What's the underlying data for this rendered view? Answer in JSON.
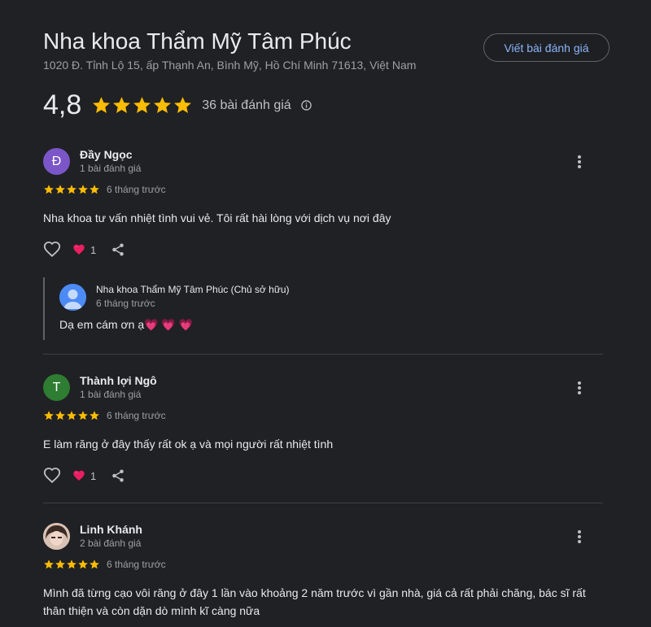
{
  "place": {
    "title": "Nha khoa Thẩm Mỹ Tâm Phúc",
    "address": "1020 Đ. Tỉnh Lộ 15, ấp Thạnh An, Bình Mỹ, Hồ Chí Minh 71613, Việt Nam",
    "rating": "4,8",
    "review_count": "36 bài đánh giá",
    "write_review_label": "Viết bài đánh giá"
  },
  "colors": {
    "star": "#fbbc04",
    "link": "#8ab4f8",
    "heart": "#e91e63"
  },
  "reviews": [
    {
      "avatar_letter": "Đ",
      "avatar_color": "#7b56c8",
      "name": "Đầy Ngọc",
      "meta": "1 bài đánh giá",
      "stars": 5,
      "time": "6 tháng trước",
      "text": "Nha khoa tư vấn nhiệt tình vui vẻ. Tôi rất hài lòng với dịch vụ nơi đây",
      "reactions": "1",
      "reply": {
        "name": "Nha khoa Thẩm Mỹ Tâm Phúc (Chủ sở hữu)",
        "time": "6 tháng trước",
        "text": "Dạ em cám ơn ạ💗 💗 💗"
      }
    },
    {
      "avatar_letter": "T",
      "avatar_color": "#2e7d32",
      "name": "Thành lợi Ngô",
      "meta": "1 bài đánh giá",
      "stars": 5,
      "time": "6 tháng trước",
      "text": "E làm răng ở đây thấy rất ok ạ và mọi người rất nhiệt tình",
      "reactions": "1"
    },
    {
      "avatar_letter": "",
      "avatar_color": "#c8a89a",
      "name": "Linh Khánh",
      "meta": "2 bài đánh giá",
      "stars": 5,
      "time": "6 tháng trước",
      "text": "Mình đã từng cạo vôi răng ở đây 1 lần vào khoảng 2 năm trước vì gần nhà, giá cả rất phải chăng, bác sĩ rất thân thiện và còn dặn dò mình kĩ càng nữa"
    }
  ]
}
